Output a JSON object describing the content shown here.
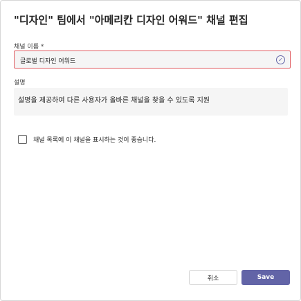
{
  "dialog": {
    "title": "\"디자인\" 팀에서 \"아메리칸 디자인 어워드\" 채널 편집",
    "name_field": {
      "label": "채널 이름 *",
      "value": "글로벌 디자인 어워드",
      "valid_icon": "check-circle-icon"
    },
    "description_field": {
      "label": "설명",
      "value": "설명을 제공하여 다른 사용자가 올바른 채널을 찾을 수 있도록 지원"
    },
    "show_in_list": {
      "label": "채널 목록에 이 채널을 표시하는 것이 좋습니다.",
      "checked": false
    },
    "buttons": {
      "cancel": "취소",
      "save": "Save"
    },
    "colors": {
      "accent": "#6264a7",
      "error_border": "#e05a5f"
    }
  }
}
